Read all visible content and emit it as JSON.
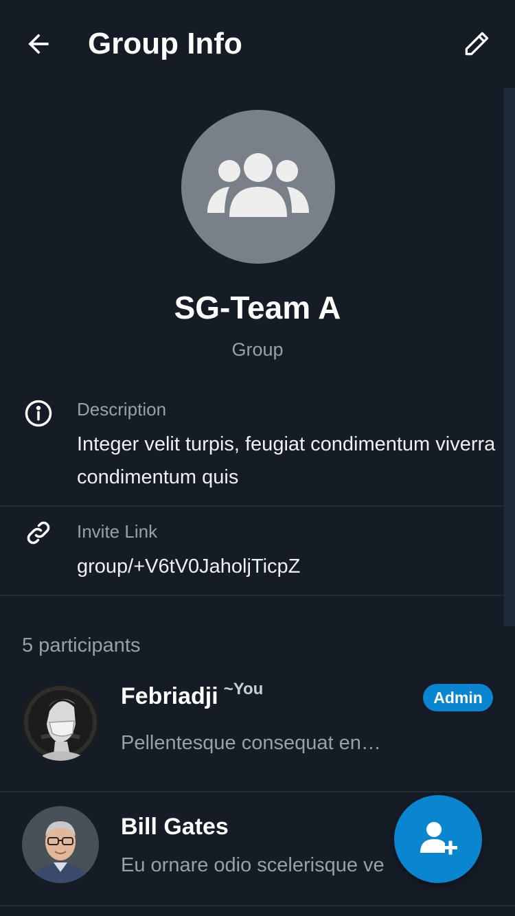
{
  "header": {
    "title": "Group Info",
    "back_icon": "arrow-left-icon",
    "edit_icon": "pencil-icon"
  },
  "group": {
    "avatar_icon": "group-people-icon",
    "name": "SG-Team A",
    "type": "Group"
  },
  "description": {
    "icon": "info-circle-icon",
    "label": "Description",
    "value": "Integer velit turpis, feugiat condimentum viverra condimentum quis"
  },
  "invite": {
    "icon": "link-icon",
    "label": "Invite Link",
    "value": "group/+V6tV0JaholjTicpZ"
  },
  "participants": {
    "count_label": "5 participants",
    "items": [
      {
        "name": "Febriadji",
        "you_tag": "~You",
        "status": "Pellentesque consequat en…",
        "badge": "Admin"
      },
      {
        "name": "Bill Gates",
        "status": "Eu ornare odio scelerisque ve"
      }
    ]
  },
  "fab": {
    "icon": "add-person-icon"
  },
  "colors": {
    "background": "#161c26",
    "accent": "#0a86d0",
    "muted_text": "#9aa0a8",
    "avatar_gray": "#7a8088"
  }
}
